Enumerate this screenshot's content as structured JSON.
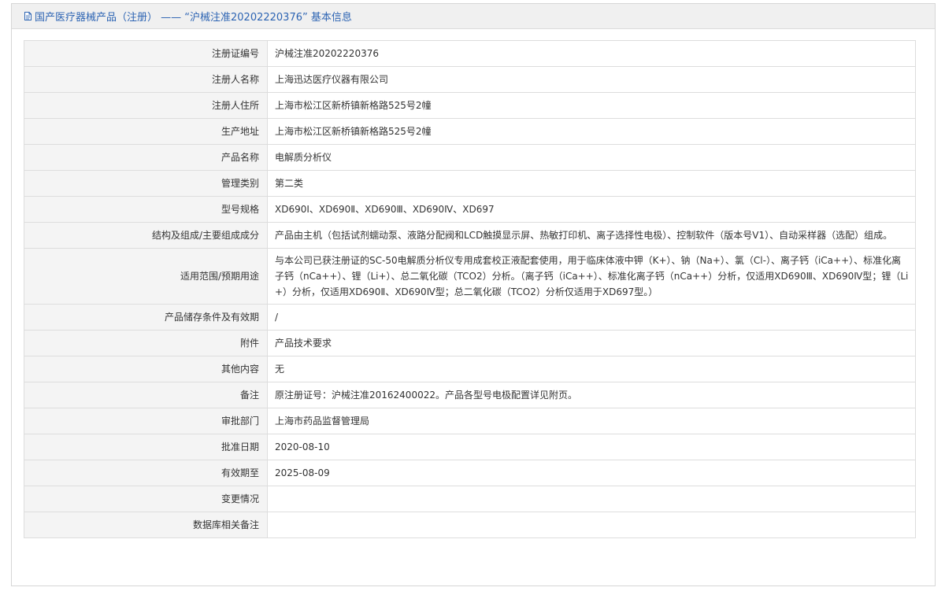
{
  "header": {
    "icon": "document-icon",
    "title": "国产医疗器械产品（注册） —— “沪械注准20202220376” 基本信息"
  },
  "rows": [
    {
      "label": "注册证编号",
      "value": "沪械注准20202220376"
    },
    {
      "label": "注册人名称",
      "value": "上海迅达医疗仪器有限公司"
    },
    {
      "label": "注册人住所",
      "value": "上海市松江区新桥镇新格路525号2幢"
    },
    {
      "label": "生产地址",
      "value": "上海市松江区新桥镇新格路525号2幢"
    },
    {
      "label": "产品名称",
      "value": "电解质分析仪"
    },
    {
      "label": "管理类别",
      "value": "第二类"
    },
    {
      "label": "型号规格",
      "value": "XD690Ⅰ、XD690Ⅱ、XD690Ⅲ、XD690Ⅳ、XD697"
    },
    {
      "label": "结构及组成/主要组成成分",
      "value": "产品由主机（包括试剂蠕动泵、液路分配阀和LCD触摸显示屏、热敏打印机、离子选择性电极）、控制软件（版本号V1）、自动采样器（选配）组成。"
    },
    {
      "label": "适用范围/预期用途",
      "value": "与本公司已获注册证的SC-50电解质分析仪专用成套校正液配套使用，用于临床体液中钾（K+）、钠（Na+）、氯（Cl-）、离子钙（iCa++）、标准化离子钙（nCa++）、锂（Li+）、总二氧化碳（TCO2）分析。（离子钙（iCa++）、标准化离子钙（nCa++）分析，仅适用XD690Ⅲ、XD690Ⅳ型；锂（Li+）分析，仅适用XD690Ⅱ、XD690Ⅳ型；总二氧化碳（TCO2）分析仅适用于XD697型。）"
    },
    {
      "label": "产品储存条件及有效期",
      "value": "/"
    },
    {
      "label": "附件",
      "value": "产品技术要求"
    },
    {
      "label": "其他内容",
      "value": "无"
    },
    {
      "label": "备注",
      "value": "原注册证号：沪械注准20162400022。产品各型号电极配置详见附页。"
    },
    {
      "label": "审批部门",
      "value": "上海市药品监督管理局"
    },
    {
      "label": "批准日期",
      "value": "2020-08-10"
    },
    {
      "label": "有效期至",
      "value": "2025-08-09"
    },
    {
      "label": "变更情况",
      "value": ""
    },
    {
      "label": "数据库相关备注",
      "value": ""
    }
  ]
}
